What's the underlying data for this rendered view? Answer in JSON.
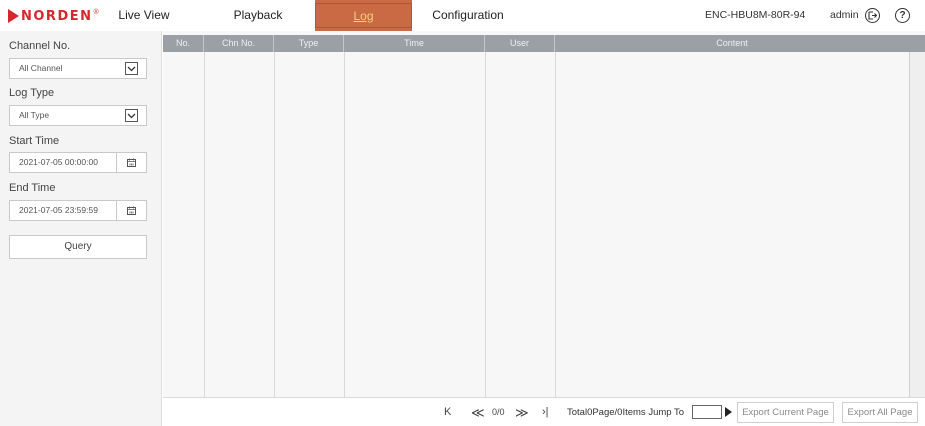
{
  "brand": {
    "name": "NORDEN",
    "mark": "®"
  },
  "nav": {
    "live_view": "Live View",
    "playback": "Playback",
    "log": "Log",
    "configuration": "Configuration"
  },
  "device_name": "ENC-HBU8M-80R-94",
  "user_name": "admin",
  "icons": {
    "logout": "logout-icon",
    "help": "?",
    "calendar": "calendar-icon",
    "dropdown": "chevron-down-icon"
  },
  "sidebar": {
    "channel_label": "Channel No.",
    "channel_value": "All Channel",
    "log_type_label": "Log Type",
    "log_type_value": "All Type",
    "start_label": "Start Time",
    "start_value": "2021-07-05 00:00:00",
    "end_label": "End Time",
    "end_value": "2021-07-05 23:59:59",
    "query_label": "Query"
  },
  "table": {
    "columns": [
      "No.",
      "Chn No.",
      "Type",
      "Time",
      "User",
      "Content"
    ],
    "rows": []
  },
  "pagination": {
    "first": "K",
    "prev": "≪",
    "count": "0/0",
    "next": "≫",
    "last": "›|",
    "total_text": "Total0Page/0Items Jump To",
    "jump_value": "",
    "export_current": "Export Current Page",
    "export_all": "Export All Page"
  },
  "colors": {
    "brand_red": "#d8262d",
    "active_tab": "#c96a44",
    "active_tab_text": "#f2d27a",
    "header_gray": "#9aa0a6"
  }
}
